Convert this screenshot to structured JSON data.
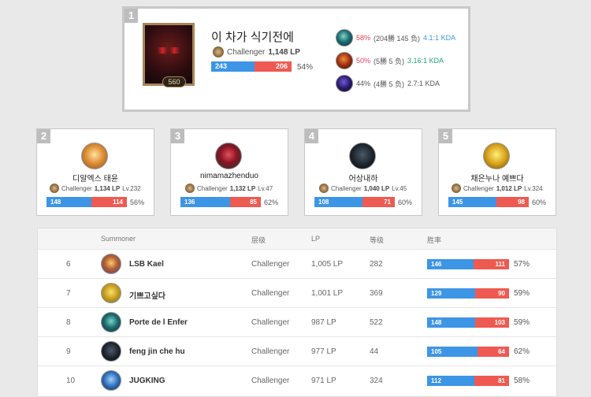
{
  "rank1": {
    "rank": "1",
    "name": "이 차가 식기전에",
    "tier": "Challenger",
    "lp": "1,148 LP",
    "level": "560",
    "wins": "243",
    "losses": "206",
    "win_ratio": 0.54,
    "winrate": "54%",
    "champions": [
      {
        "pct": "58%",
        "record": "(204勝 145 负)",
        "kda": "4.1:1 KDA",
        "kda_color": "#3d95e5"
      },
      {
        "pct": "50%",
        "record": "(5勝 5 负)",
        "kda": "3.16:1 KDA",
        "kda_color": "#1fa37a"
      },
      {
        "pct": "44%",
        "record": "(4勝 5 负)",
        "kda": "2.7:1 KDA",
        "kda_color": "#555555"
      }
    ]
  },
  "cards": [
    {
      "rank": "2",
      "name": "디알엑스 태윤",
      "tier": "Challenger",
      "lp": "1,134 LP",
      "level": "Lv.232",
      "wins": "148",
      "losses": "114",
      "win_ratio": 0.56,
      "winrate": "56%"
    },
    {
      "rank": "3",
      "name": "nimamazhenduo",
      "tier": "Challenger",
      "lp": "1,132 LP",
      "level": "Lv.47",
      "wins": "136",
      "losses": "85",
      "win_ratio": 0.62,
      "winrate": "62%"
    },
    {
      "rank": "4",
      "name": "어상내하",
      "tier": "Challenger",
      "lp": "1,040 LP",
      "level": "Lv.45",
      "wins": "108",
      "losses": "71",
      "win_ratio": 0.6,
      "winrate": "60%"
    },
    {
      "rank": "5",
      "name": "채은누나 예쁘다",
      "tier": "Challenger",
      "lp": "1,012 LP",
      "level": "Lv.324",
      "wins": "145",
      "losses": "98",
      "win_ratio": 0.6,
      "winrate": "60%"
    }
  ],
  "table": {
    "headers": {
      "summoner": "Summoner",
      "tier": "层级",
      "lp": "LP",
      "level": "等级",
      "winrate": "胜率"
    },
    "rows": [
      {
        "rank": "6",
        "name": "LSB Kael",
        "tier": "Challenger",
        "lp": "1,005 LP",
        "level": "282",
        "wins": "146",
        "losses": "111",
        "win_ratio": 0.57,
        "winrate": "57%"
      },
      {
        "rank": "7",
        "name": "기쁘고싶다",
        "tier": "Challenger",
        "lp": "1,001 LP",
        "level": "369",
        "wins": "129",
        "losses": "90",
        "win_ratio": 0.59,
        "winrate": "59%"
      },
      {
        "rank": "8",
        "name": "Porte de l Enfer",
        "tier": "Challenger",
        "lp": "987 LP",
        "level": "522",
        "wins": "148",
        "losses": "103",
        "win_ratio": 0.59,
        "winrate": "59%"
      },
      {
        "rank": "9",
        "name": "feng jin che hu",
        "tier": "Challenger",
        "lp": "977 LP",
        "level": "44",
        "wins": "105",
        "losses": "64",
        "win_ratio": 0.62,
        "winrate": "62%"
      },
      {
        "rank": "10",
        "name": "JUGKING",
        "tier": "Challenger",
        "lp": "971 LP",
        "level": "324",
        "wins": "112",
        "losses": "81",
        "win_ratio": 0.58,
        "winrate": "58%"
      }
    ]
  }
}
